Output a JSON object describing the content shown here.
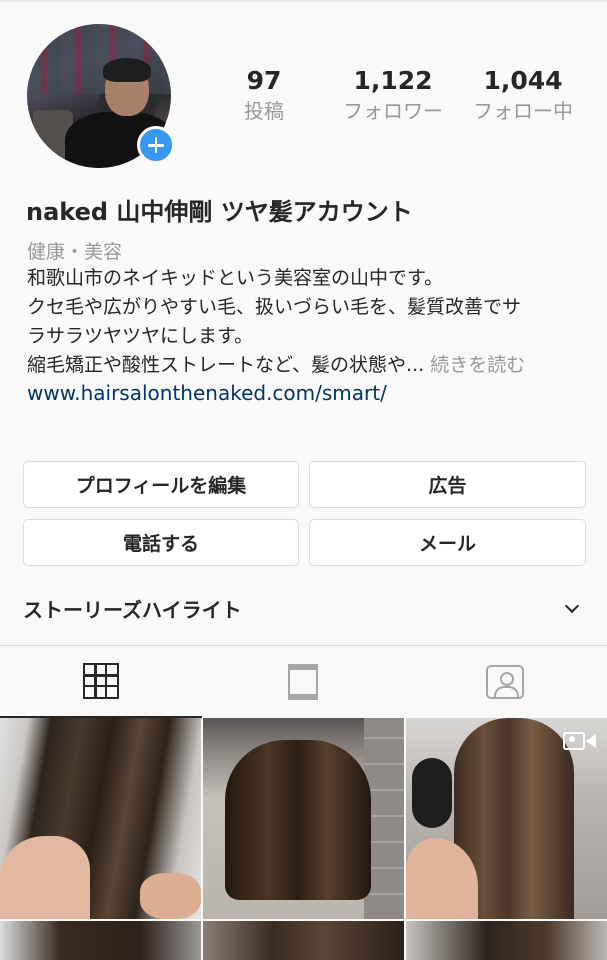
{
  "profile": {
    "stats": {
      "posts_count": "97",
      "posts_label": "投稿",
      "followers_count": "1,122",
      "followers_label": "フォロワー",
      "following_count": "1,044",
      "following_label": "フォロー中"
    },
    "name": "naked 山中伸剛 ツヤ髪アカウント",
    "category": "健康・美容",
    "bio_lines": [
      "和歌山市のネイキッドという美容室の山中です。",
      "クセ毛や広がりやすい毛、扱いづらい毛を、髪質改善でサ",
      "ラサラツヤツヤにします。",
      "縮毛矯正や酸性ストレートなど、髪の状態や..."
    ],
    "more_link": " 続きを読む",
    "website": "www.hairsalonthenaked.com/smart/"
  },
  "buttons": {
    "edit_profile": "プロフィールを編集",
    "ads": "広告",
    "call": "電話する",
    "email": "メール"
  },
  "highlights": {
    "label": "ストーリーズハイライト"
  },
  "tabs": [
    {
      "icon": "grid-icon",
      "active": true
    },
    {
      "icon": "feed-list-icon",
      "active": false
    },
    {
      "icon": "tagged-person-icon",
      "active": false
    }
  ],
  "colors": {
    "accent": "#3897f0",
    "link": "#003569",
    "muted": "#999999",
    "text": "#262626",
    "border": "#dbdbdb"
  }
}
